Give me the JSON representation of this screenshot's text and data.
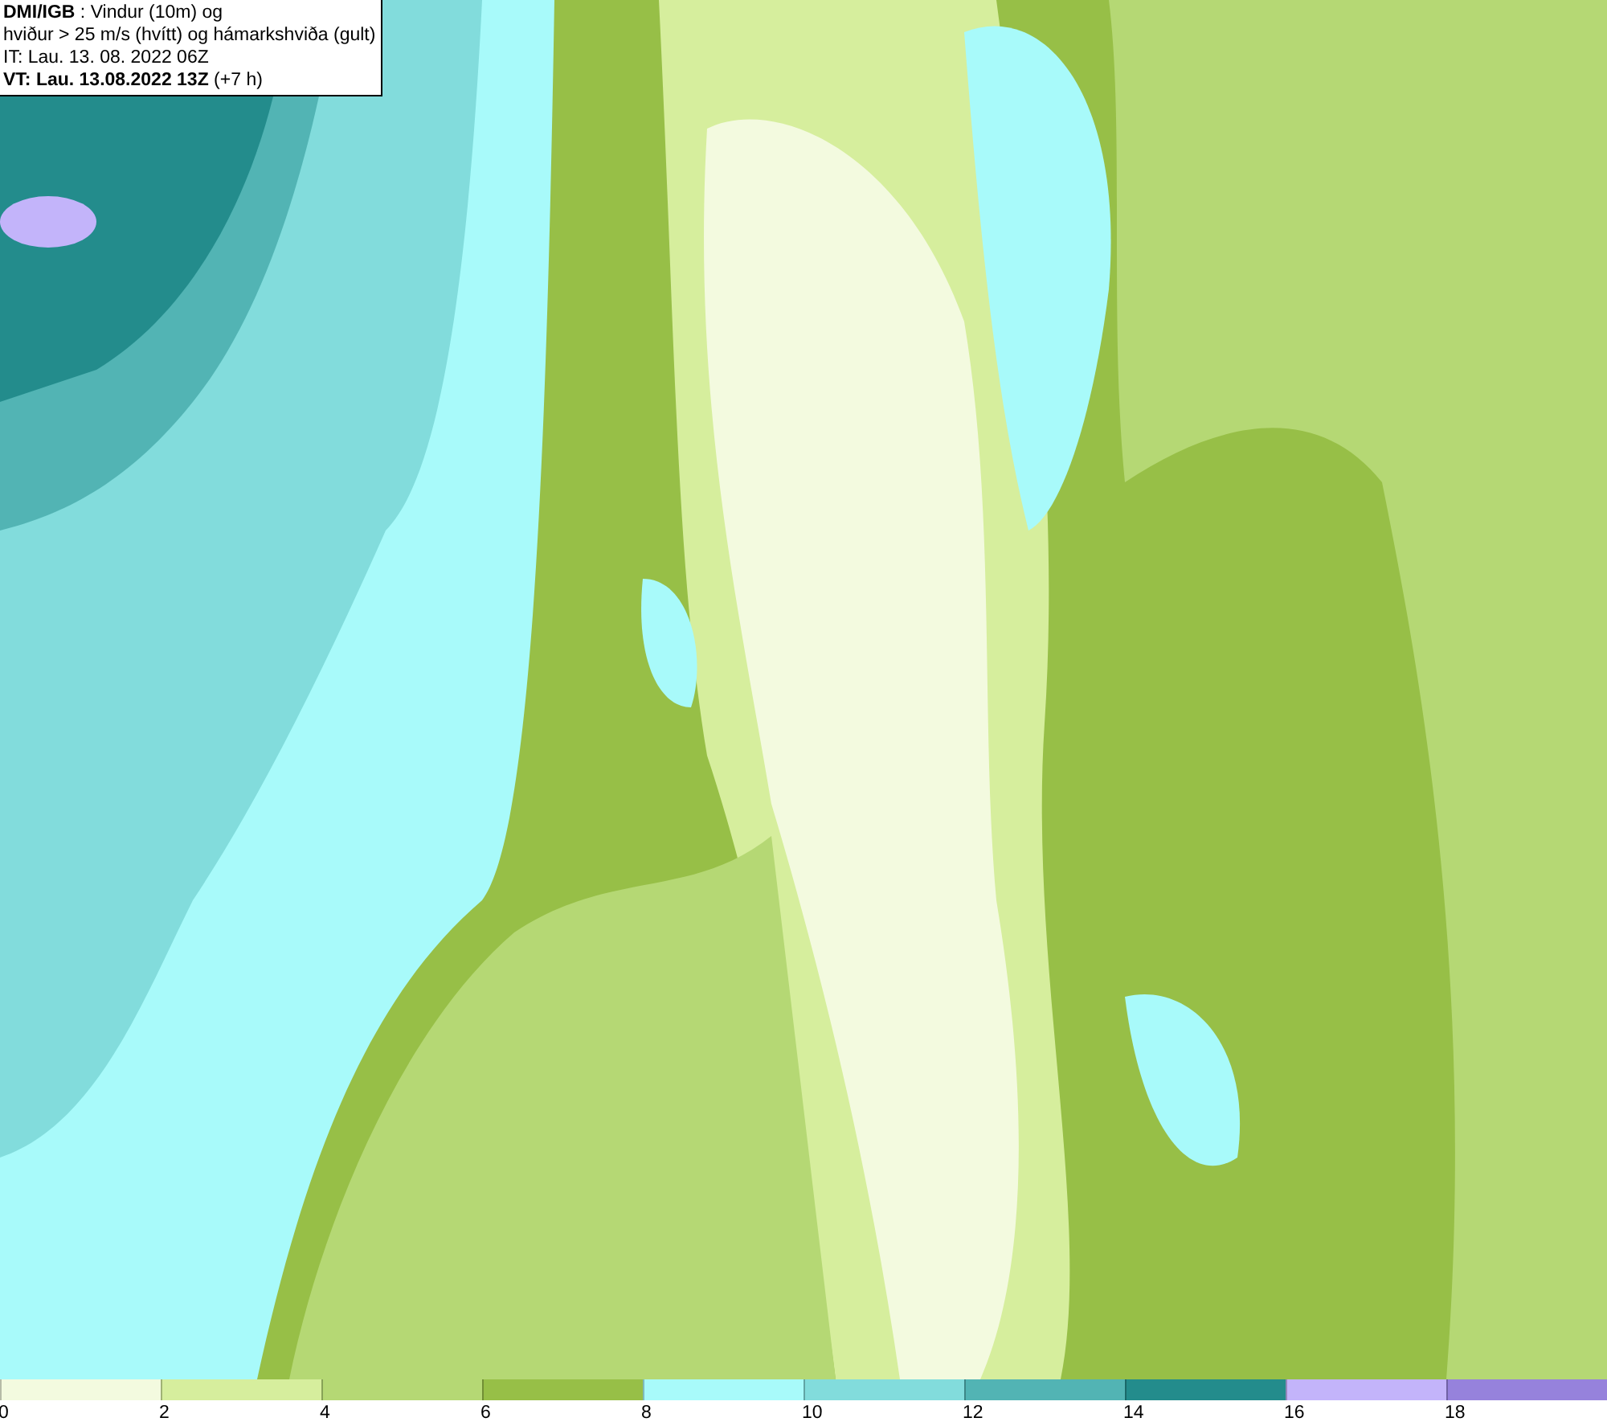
{
  "header": {
    "lines": [
      "**DMI/IGB** : Vindur (10m) og",
      "hviður > 25 m/s (hvítt) og hámarkshviða (gult)",
      "IT: Lau. 13. 08. 2022 06Z",
      "**VT: Lau. 13.08.2022 13Z** (+7 h)"
    ]
  },
  "legend": {
    "bins": [
      {
        "color": "#f3fadf"
      },
      {
        "color": "#d6ee9d"
      },
      {
        "color": "#b5d874"
      },
      {
        "color": "#97bf47"
      },
      {
        "color": "#a8fafa"
      },
      {
        "color": "#82dcdc"
      },
      {
        "color": "#52b4b4"
      },
      {
        "color": "#238c8c"
      },
      {
        "color": "#c3b4fa"
      },
      {
        "color": "#9682dc"
      }
    ],
    "ticks": [
      "0",
      "2",
      "4",
      "6",
      "8",
      "10",
      "12",
      "14",
      "16",
      "18"
    ]
  }
}
